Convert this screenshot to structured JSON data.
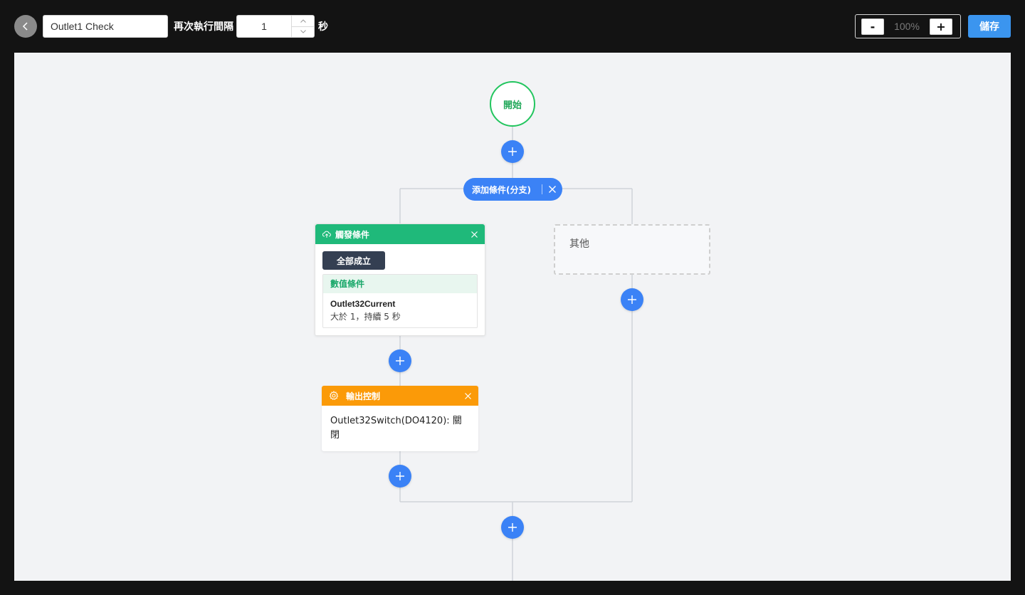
{
  "topbar": {
    "rule_name": "Outlet1 Check",
    "interval_label": "再次執行間隔",
    "interval_value": "1",
    "seconds_label": "秒",
    "zoom_minus": "-",
    "zoom_value": "100%",
    "zoom_plus": "+",
    "save_label": "儲存"
  },
  "flow": {
    "start_label": "開始",
    "branch_label": "添加條件(分支)",
    "trigger": {
      "title": "觸發條件",
      "all_label": "全部成立",
      "condition_type": "數值條件",
      "condition_name": "Outlet32Current",
      "condition_desc": "大於 1，持續 5 秒"
    },
    "output": {
      "title": "輸出控制",
      "text": "Outlet32Switch(DO4120): 關閉"
    },
    "other_label": "其他"
  },
  "colors": {
    "accent_blue": "#3b82f6",
    "save_blue": "#3b95ef",
    "trigger_green": "#1fb97a",
    "start_green": "#22c55e",
    "output_orange": "#fb9a08",
    "canvas_bg": "#f2f3f5",
    "topbar_bg": "#131313"
  }
}
